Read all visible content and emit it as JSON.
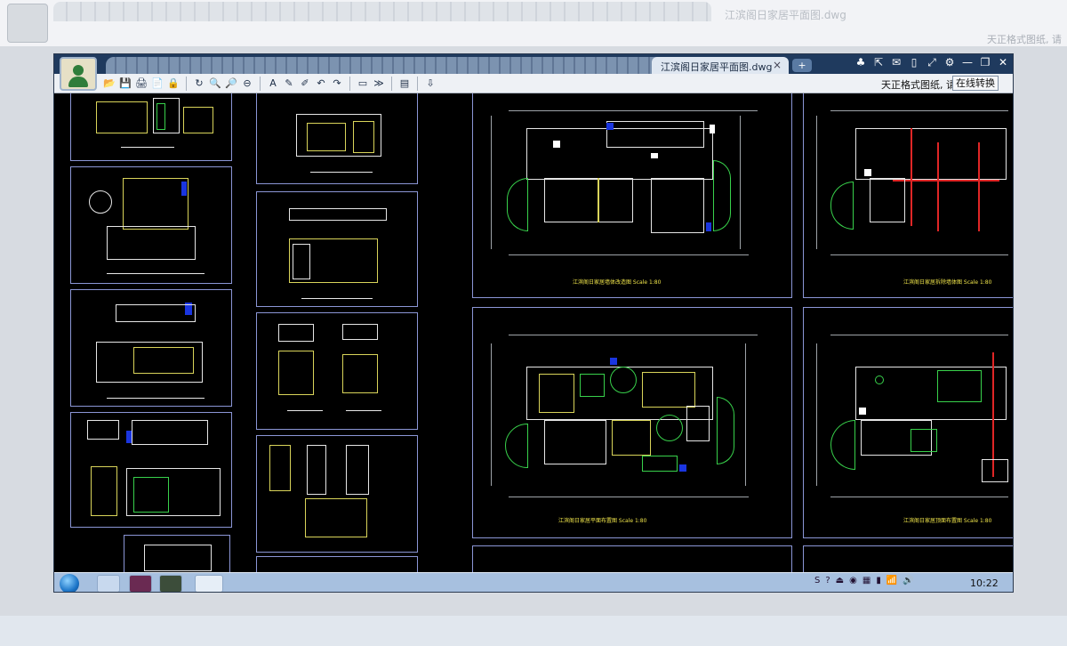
{
  "window": {
    "tab_title": "江滨阁日家居平面图.dwg",
    "tab_close": "×",
    "new_tab": "+",
    "controls": [
      "♣",
      "⇱",
      "✉",
      "▯",
      "⤢",
      "⚙",
      "—",
      "❐",
      "✕"
    ]
  },
  "toolbar": {
    "tools": [
      "📂",
      "💾",
      "🖨",
      "📄",
      "🔒",
      "|",
      "↻",
      "🔍",
      "🔎",
      "⊖",
      "|",
      "A",
      "✎",
      "✐",
      "↶",
      "↷",
      "|",
      "▭",
      "≫",
      "|",
      "▤",
      "|",
      "⇩"
    ],
    "hint": "天正格式图纸, 请",
    "convert_label": "在线转换"
  },
  "sheets": {
    "plan_1": "江滨阁日家居墙体改造图  Scale 1:80",
    "plan_2": "江滨阁日家居拆除墙体图  Scale 1:80",
    "plan_3": "江滨阁日家居平面布置图  Scale 1:80",
    "plan_4": "江滨阁日家居顶面布置图  Scale 1:80"
  },
  "taskbar": {
    "clock": "10:22",
    "tray": [
      "S",
      "?",
      "⏏",
      "◉",
      "▦",
      "▮",
      "📶",
      "🔊"
    ]
  },
  "background": {
    "title": "江滨阁日家居平面图.dwg",
    "hint": "天正格式图纸, 请"
  }
}
